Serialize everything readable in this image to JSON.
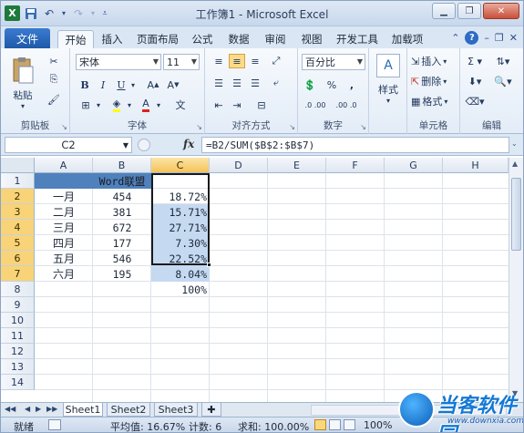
{
  "window": {
    "title": "工作簿1 - Microsoft Excel",
    "app_icon": "X"
  },
  "ribbon": {
    "file_tab": "文件",
    "tabs": [
      "开始",
      "插入",
      "页面布局",
      "公式",
      "数据",
      "审阅",
      "视图",
      "开发工具",
      "加载项"
    ],
    "active_tab": "开始",
    "font_name": "宋体",
    "font_size": "11",
    "number_format": "百分比",
    "groups": {
      "clipboard": "剪贴板",
      "paste": "粘贴",
      "font": "字体",
      "alignment": "对齐方式",
      "number": "数字",
      "styles": "样式",
      "cells": "单元格",
      "editing": "编辑"
    },
    "cells_buttons": {
      "insert": "插入",
      "delete": "删除",
      "format": "格式"
    },
    "number_buttons": {
      "percent": "%",
      "comma": ",",
      "inc_decimal": ".0 .00",
      "dec_decimal": ".00 .0"
    }
  },
  "formula_bar": {
    "name_box": "C2",
    "fx": "fx",
    "formula": "=B2/SUM($B$2:$B$7)"
  },
  "grid": {
    "columns": [
      "A",
      "B",
      "C",
      "D",
      "E",
      "F",
      "G",
      "H"
    ],
    "rows": [
      "1",
      "2",
      "3",
      "4",
      "5",
      "6",
      "7",
      "8",
      "9",
      "10",
      "11",
      "12",
      "13",
      "14"
    ],
    "selected_column": "C",
    "header_b1": "Word联盟",
    "data": [
      {
        "month": "一月",
        "value": "454",
        "pct": "18.72%"
      },
      {
        "month": "二月",
        "value": "381",
        "pct": "15.71%"
      },
      {
        "month": "三月",
        "value": "672",
        "pct": "27.71%"
      },
      {
        "month": "四月",
        "value": "177",
        "pct": "7.30%"
      },
      {
        "month": "五月",
        "value": "546",
        "pct": "22.52%"
      },
      {
        "month": "六月",
        "value": "195",
        "pct": "8.04%"
      }
    ],
    "total_c8": "100%"
  },
  "sheets": {
    "tabs": [
      "Sheet1",
      "Sheet2",
      "Sheet3"
    ],
    "active": "Sheet1"
  },
  "status_bar": {
    "mode": "就绪",
    "average": "平均值: 16.67%",
    "count": "计数: 6",
    "sum": "求和: 100.00%",
    "zoom": "100%"
  },
  "watermark": {
    "text": "当客软件园",
    "url": "www.downxia.com"
  },
  "colors": {
    "header_fill": "#4f81bd",
    "selection_fill": "#c5d9f1",
    "file_tab": "#1e5aa8"
  }
}
